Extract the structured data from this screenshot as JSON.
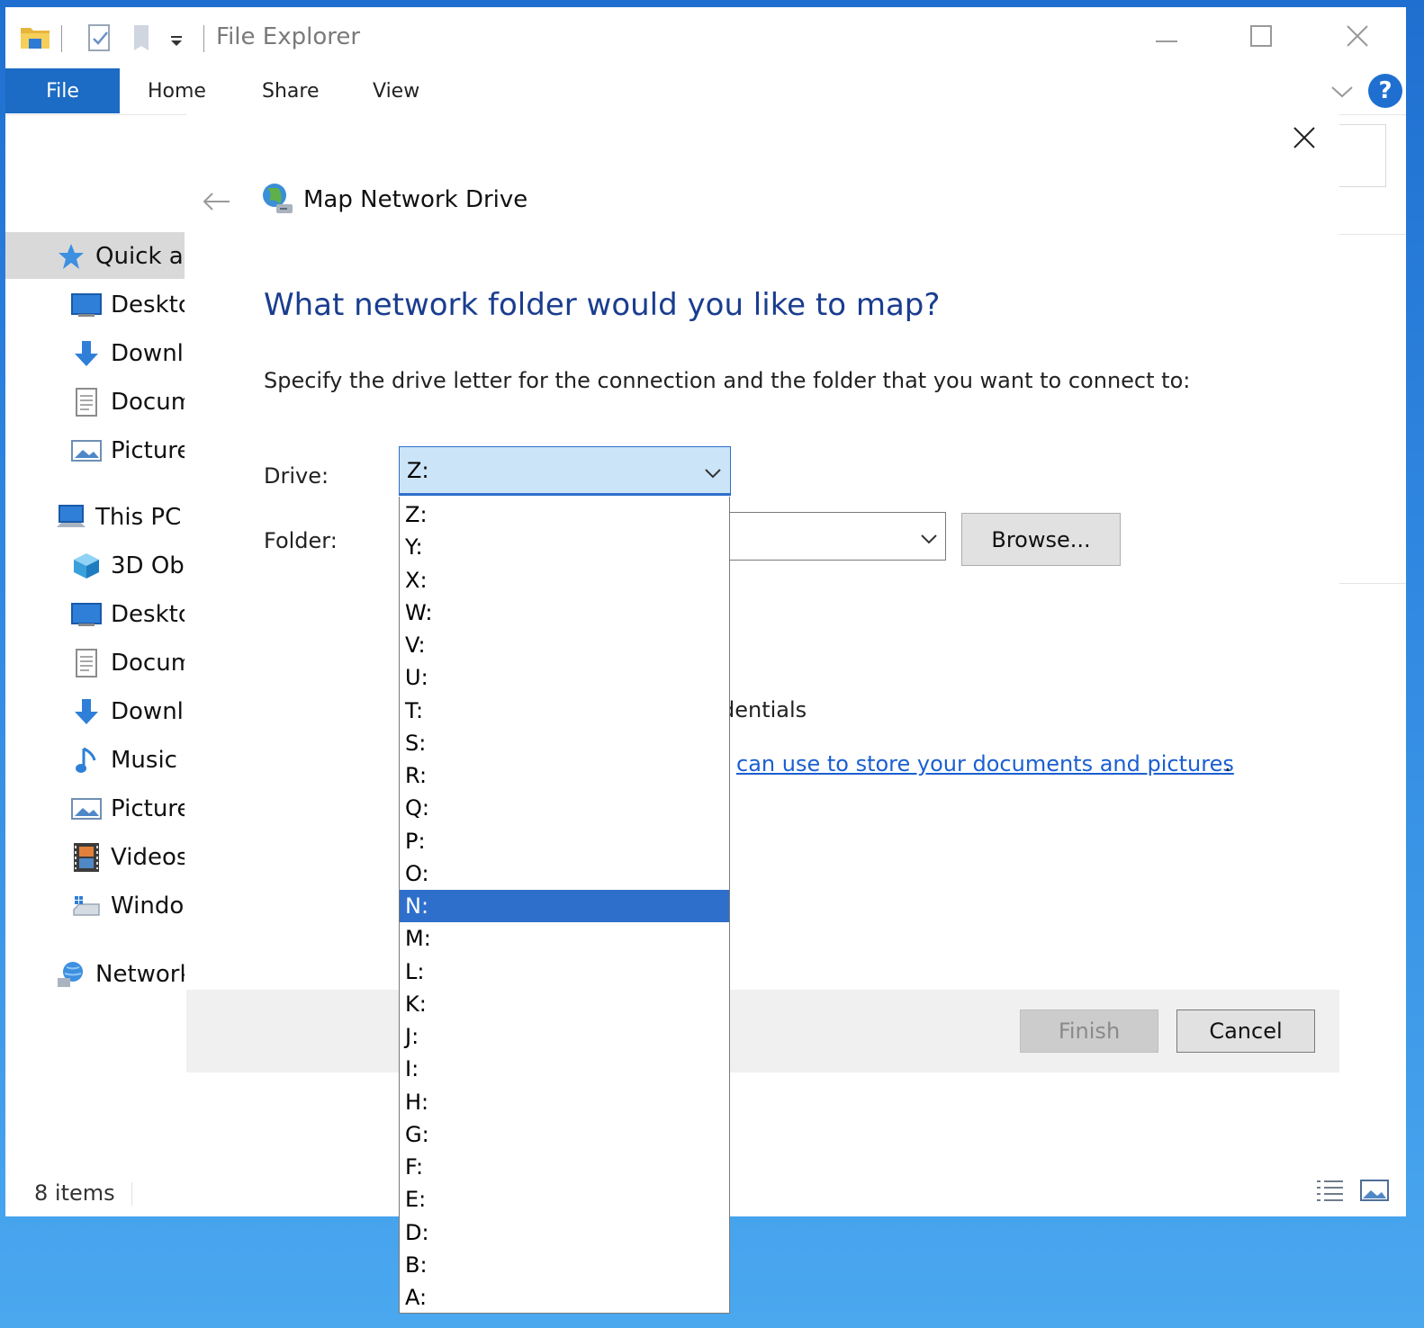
{
  "window": {
    "title": "File Explorer",
    "help_label": "?"
  },
  "ribbon": {
    "tabs": [
      "File",
      "Home",
      "Share",
      "View"
    ]
  },
  "nav": {
    "items": [
      {
        "label": "Quick ac",
        "icon": "star-icon"
      },
      {
        "label": "Desktc",
        "icon": "desktop-icon"
      },
      {
        "label": "Downl",
        "icon": "download-arrow-icon"
      },
      {
        "label": "Docum",
        "icon": "document-icon"
      },
      {
        "label": "Picture",
        "icon": "picture-icon"
      },
      {
        "label": "This PC",
        "icon": "computer-icon"
      },
      {
        "label": "3D Ob",
        "icon": "cube-icon"
      },
      {
        "label": "Desktc",
        "icon": "desktop-icon"
      },
      {
        "label": "Docum",
        "icon": "document-icon"
      },
      {
        "label": "Downl",
        "icon": "download-arrow-icon"
      },
      {
        "label": "Music",
        "icon": "music-note-icon"
      },
      {
        "label": "Picture",
        "icon": "picture-icon"
      },
      {
        "label": "Videos",
        "icon": "film-icon"
      },
      {
        "label": "Windo",
        "icon": "drive-icon"
      },
      {
        "label": "Network",
        "icon": "network-icon"
      }
    ]
  },
  "status": {
    "items_count": "8 items"
  },
  "dialog": {
    "title": "Map Network Drive",
    "heading": "What network folder would you like to map?",
    "instruction": "Specify the drive letter for the connection and the folder that you want to connect to:",
    "drive_label": "Drive:",
    "drive_value": "Z:",
    "folder_label": "Folder:",
    "folder_value": "",
    "browse_label": "Browse...",
    "credentials_fragment": "dentials",
    "link_fragment": "can use to store your documents and pictures",
    "link_period": ".",
    "finish_label": "Finish",
    "cancel_label": "Cancel"
  },
  "drive_options": [
    "Z:",
    "Y:",
    "X:",
    "W:",
    "V:",
    "U:",
    "T:",
    "S:",
    "R:",
    "Q:",
    "P:",
    "O:",
    "N:",
    "M:",
    "L:",
    "K:",
    "J:",
    "I:",
    "H:",
    "G:",
    "F:",
    "E:",
    "D:",
    "B:",
    "A:"
  ],
  "highlighted_option": "N:",
  "colors": {
    "accent": "#1c6bc4",
    "heading": "#1a3d8f",
    "link": "#1a5fd1",
    "selected_option": "#2f6fcc",
    "combo_bg": "#cce4f7"
  }
}
